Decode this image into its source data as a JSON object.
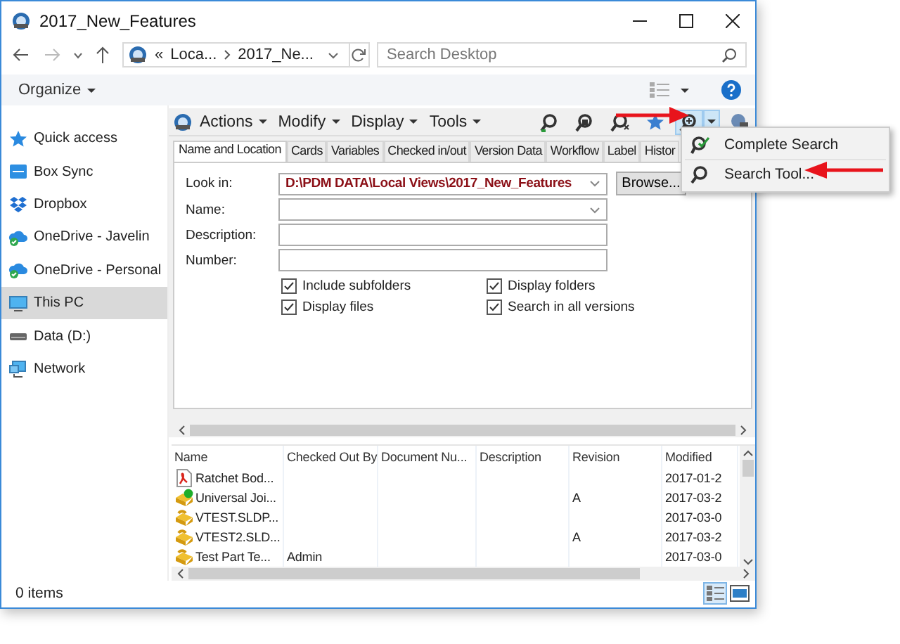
{
  "window": {
    "title": "2017_New_Features"
  },
  "address_bar": {
    "overflow": "«",
    "crumbs": [
      "Loca...",
      "2017_Ne..."
    ]
  },
  "search": {
    "placeholder": "Search Desktop"
  },
  "command_bar": {
    "organize": "Organize"
  },
  "sidebar": {
    "items": [
      {
        "label": "Quick access",
        "kind": "star",
        "selected": false
      },
      {
        "label": "Box Sync",
        "kind": "box",
        "selected": false
      },
      {
        "label": "Dropbox",
        "kind": "dropbox",
        "selected": false
      },
      {
        "label": "OneDrive - Javelin",
        "kind": "cloud",
        "selected": false
      },
      {
        "label": "OneDrive - Personal",
        "kind": "cloud",
        "selected": false
      },
      {
        "label": "This PC",
        "kind": "pc",
        "selected": true
      },
      {
        "label": "Data (D:)",
        "kind": "drive",
        "selected": false
      },
      {
        "label": "Network",
        "kind": "network",
        "selected": false
      }
    ]
  },
  "pdm_toolbar": {
    "menus": [
      "Actions",
      "Modify",
      "Display",
      "Tools"
    ]
  },
  "tabs": [
    {
      "label": "Name and Location",
      "selected": true
    },
    {
      "label": "Cards",
      "selected": false
    },
    {
      "label": "Variables",
      "selected": false
    },
    {
      "label": "Checked in/out",
      "selected": false
    },
    {
      "label": "Version Data",
      "selected": false
    },
    {
      "label": "Workflow",
      "selected": false
    },
    {
      "label": "Label",
      "selected": false
    },
    {
      "label": "Histor",
      "selected": false
    }
  ],
  "search_form": {
    "fields": [
      {
        "label": "Look in:",
        "kind": "combo",
        "value": "D:\\PDM DATA\\Local Views\\2017_New_Features"
      },
      {
        "label": "Name:",
        "kind": "combo"
      },
      {
        "label": "Description:",
        "kind": "text"
      },
      {
        "label": "Number:",
        "kind": "text"
      }
    ],
    "browse_button": "Browse...",
    "options": [
      {
        "label": "Include subfolders",
        "checked": true
      },
      {
        "label": "Display folders",
        "checked": true
      },
      {
        "label": "Display files",
        "checked": true
      },
      {
        "label": "Search in all versions",
        "checked": true
      }
    ]
  },
  "results": {
    "columns": [
      "Name",
      "Checked Out By",
      "Document Nu...",
      "Description",
      "Revision",
      "Modified"
    ],
    "rows": [
      {
        "kind": "pdf",
        "cells": [
          "Ratchet Bod...",
          "",
          "",
          "",
          "",
          "2017-01-2"
        ]
      },
      {
        "kind": "part-checked",
        "cells": [
          "Universal Joi...",
          "",
          "",
          "",
          "A",
          "2017-03-2"
        ]
      },
      {
        "kind": "part",
        "cells": [
          "VTEST.SLDP...",
          "",
          "",
          "",
          "",
          "2017-03-0"
        ]
      },
      {
        "kind": "part",
        "cells": [
          "VTEST2.SLD...",
          "",
          "",
          "",
          "A",
          "2017-03-2"
        ]
      },
      {
        "kind": "part",
        "cells": [
          "Test Part Te...",
          "Admin",
          "",
          "",
          "",
          "2017-03-0"
        ]
      }
    ]
  },
  "status_bar": {
    "text": "0 items"
  },
  "search_menu": {
    "items": [
      {
        "label": "Complete Search",
        "kind": "complete"
      },
      {
        "label": "Search Tool...",
        "kind": "tool"
      }
    ]
  }
}
